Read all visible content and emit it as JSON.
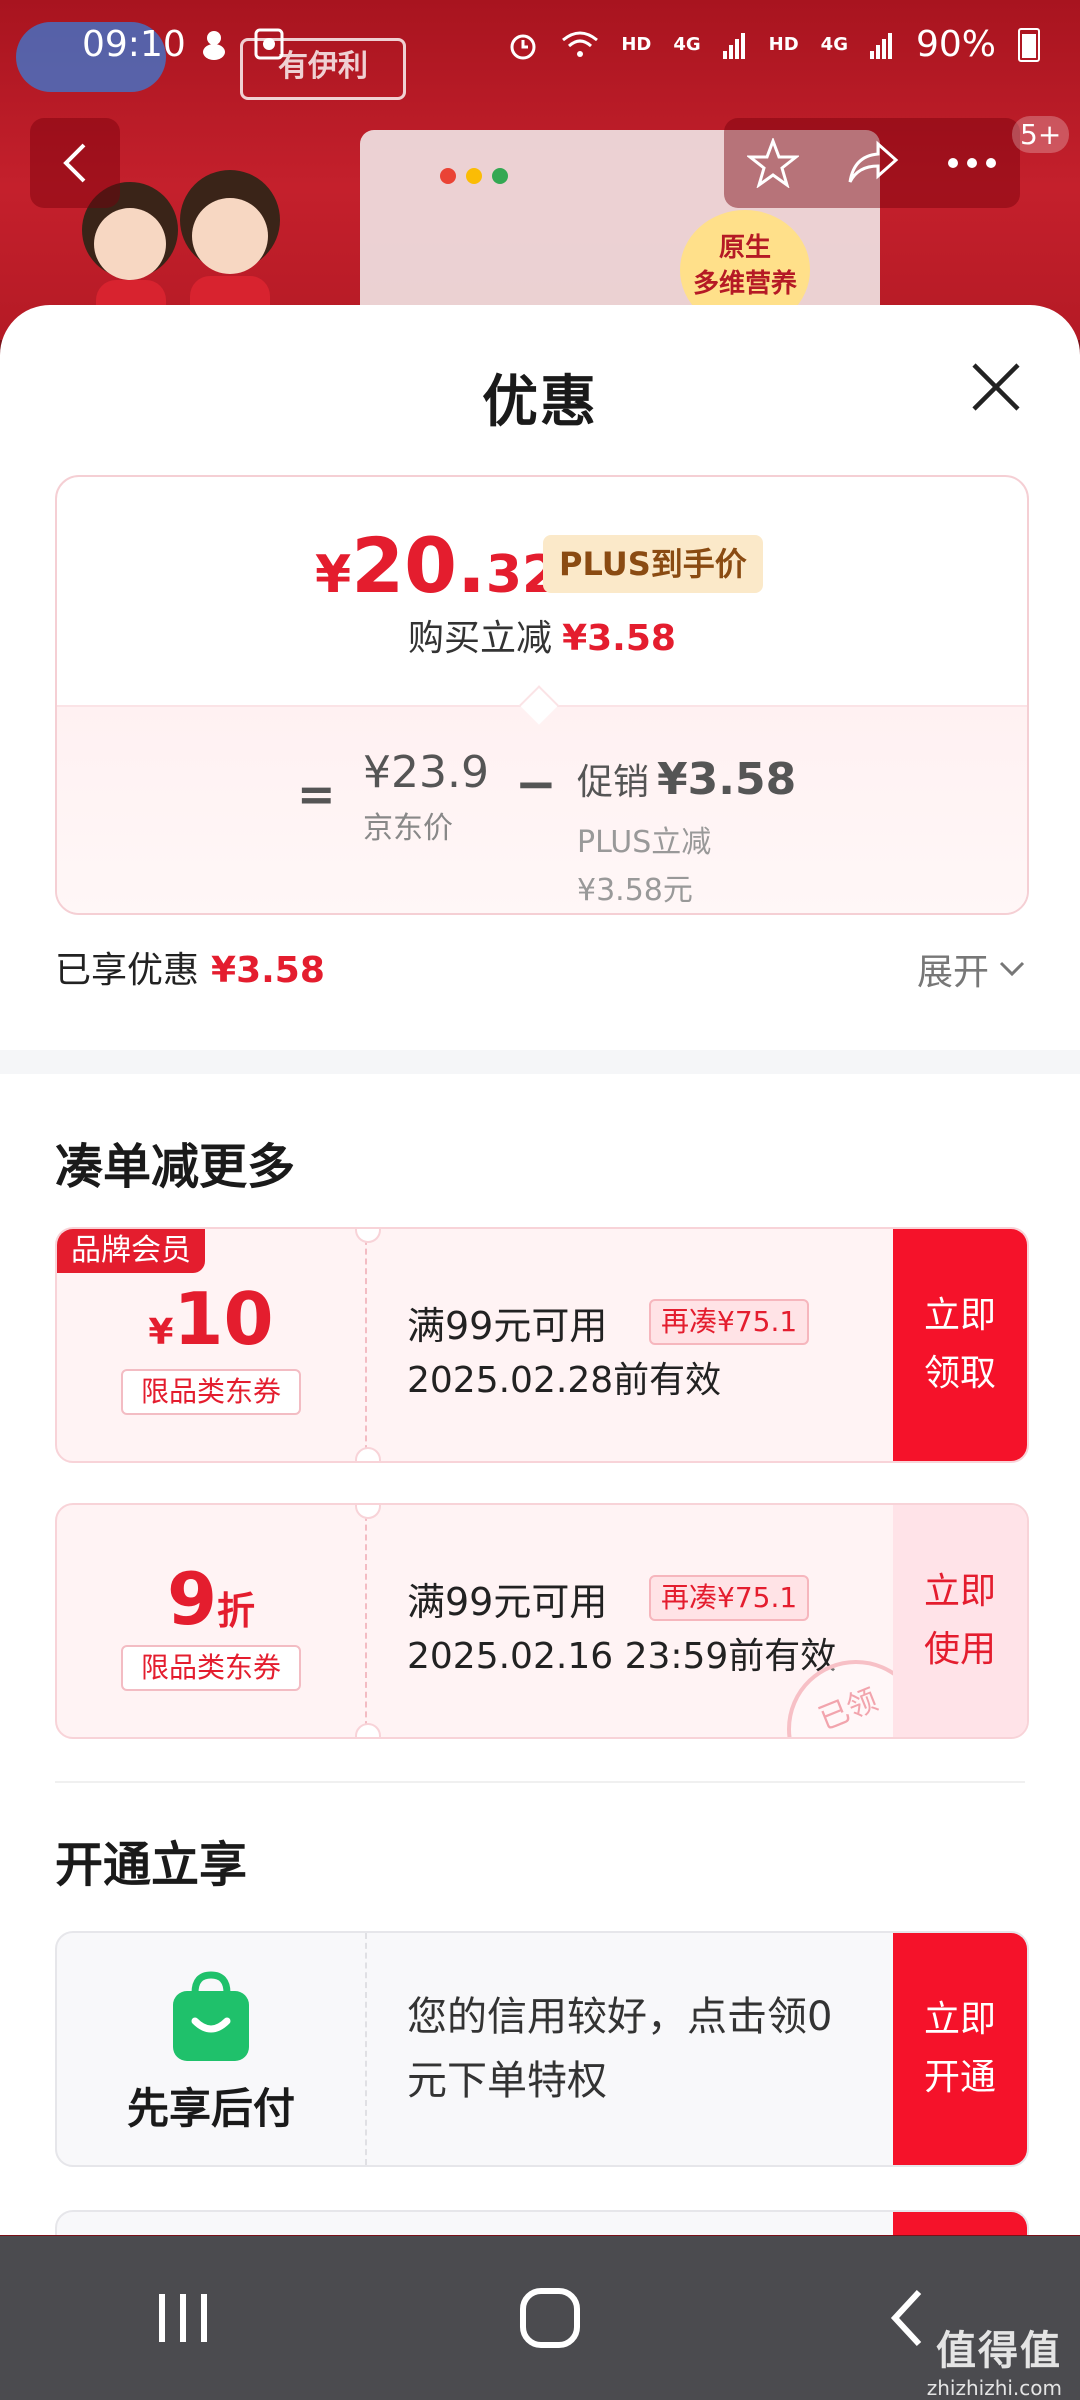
{
  "status_bar": {
    "time": "09:10",
    "hd1": "HD",
    "net1": "4G",
    "hd2": "HD",
    "net2": "4G",
    "battery": "90%"
  },
  "backdrop": {
    "badge_line1": "原生",
    "badge_line2": "多维营养",
    "slogan": "有伊利",
    "cart_count": "5+"
  },
  "sheet": {
    "title": "优惠",
    "price_summary": {
      "final_symbol": "¥",
      "final_integer": "20.",
      "final_decimal": "32",
      "plus_tag": "PLUS到手价",
      "buy_reduce_label": "购买立减",
      "buy_reduce_amount": "¥3.58",
      "equals": "=",
      "jd_price": "¥23.9",
      "jd_label": "京东价",
      "minus": "−",
      "promo_label": "促销",
      "promo_amount": "¥3.58",
      "promo_sub1": "PLUS立减",
      "promo_sub2": "¥3.58元"
    },
    "enjoyed_label": "已享优惠",
    "enjoyed_amount": "¥3.58",
    "expand_label": "展开",
    "section_more": "凑单减更多",
    "coupons": [
      {
        "brand_tag": "品牌会员",
        "symbol": "¥",
        "value": "10",
        "type": "限品类东券",
        "condition": "满99元可用",
        "extra": "再凑¥75.1",
        "validity": "2025.02.28前有效",
        "button_line1": "立即",
        "button_line2": "领取"
      },
      {
        "value": "9",
        "unit": "折",
        "type": "限品类东券",
        "condition": "满99元可用",
        "extra": "再凑¥75.1",
        "validity": "2025.02.16 23:59前有效",
        "button_line1": "立即",
        "button_line2": "使用",
        "stamp": "已领"
      }
    ],
    "section_open": "开通立享",
    "paylater": {
      "name": "先享后付",
      "text": "您的信用较好，点击领0元下单特权",
      "button_line1": "立即",
      "button_line2": "开通"
    }
  },
  "watermark": {
    "big": "值得值",
    "small": "zhizhizhi.com"
  },
  "colors": {
    "accent_red": "#e41d2e",
    "button_red": "#f5122a",
    "plus_gold_bg": "#fbe9c9"
  },
  "icons": {
    "back": "chevron-left-icon",
    "favorite": "star-icon",
    "share": "share-icon",
    "more": "more-dots-icon",
    "close": "close-icon",
    "expand": "chevron-down-icon",
    "paylater": "shopping-bag-smile-icon",
    "nav_recents": "recents-icon",
    "nav_home": "home-icon",
    "nav_back": "back-icon"
  }
}
